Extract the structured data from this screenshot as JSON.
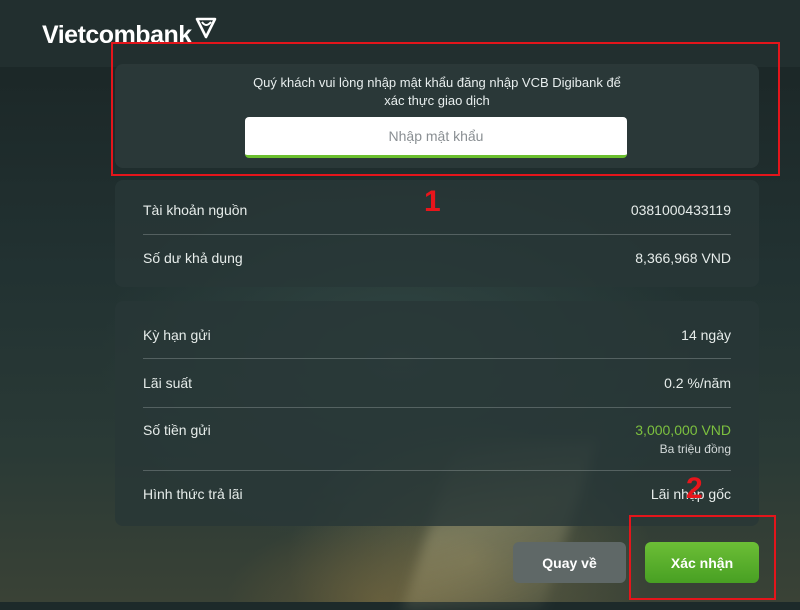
{
  "brand": {
    "name": "Vietcombank"
  },
  "password_panel": {
    "instruction_line1": "Quý khách vui lòng nhập mật khẩu đăng nhập VCB Digibank để",
    "instruction_line2": "xác thực giao dịch",
    "password_placeholder": "Nhập mật khẩu",
    "password_value": ""
  },
  "account": {
    "rows": [
      {
        "label": "Tài khoản nguồn",
        "value": "0381000433119"
      },
      {
        "label": "Số dư khả dụng",
        "value": "8,366,968 VND"
      }
    ]
  },
  "deposit": {
    "rows": [
      {
        "label": "Kỳ hạn gửi",
        "value": "14 ngày"
      },
      {
        "label": "Lãi suất",
        "value": "0.2 %/năm"
      },
      {
        "label": "Số tiền gửi",
        "value": "3,000,000 VND",
        "sub": "Ba triệu đồng"
      },
      {
        "label": "Hình thức trả lãi",
        "value": "Lãi nhập gốc"
      }
    ]
  },
  "actions": {
    "back_label": "Quay về",
    "confirm_label": "Xác nhận"
  },
  "annotations": {
    "marker_1": "1",
    "marker_2": "2"
  },
  "colors": {
    "accent_green": "#6cbe36",
    "amount_green": "#7cc03f",
    "annotation_red": "#e4151b"
  }
}
